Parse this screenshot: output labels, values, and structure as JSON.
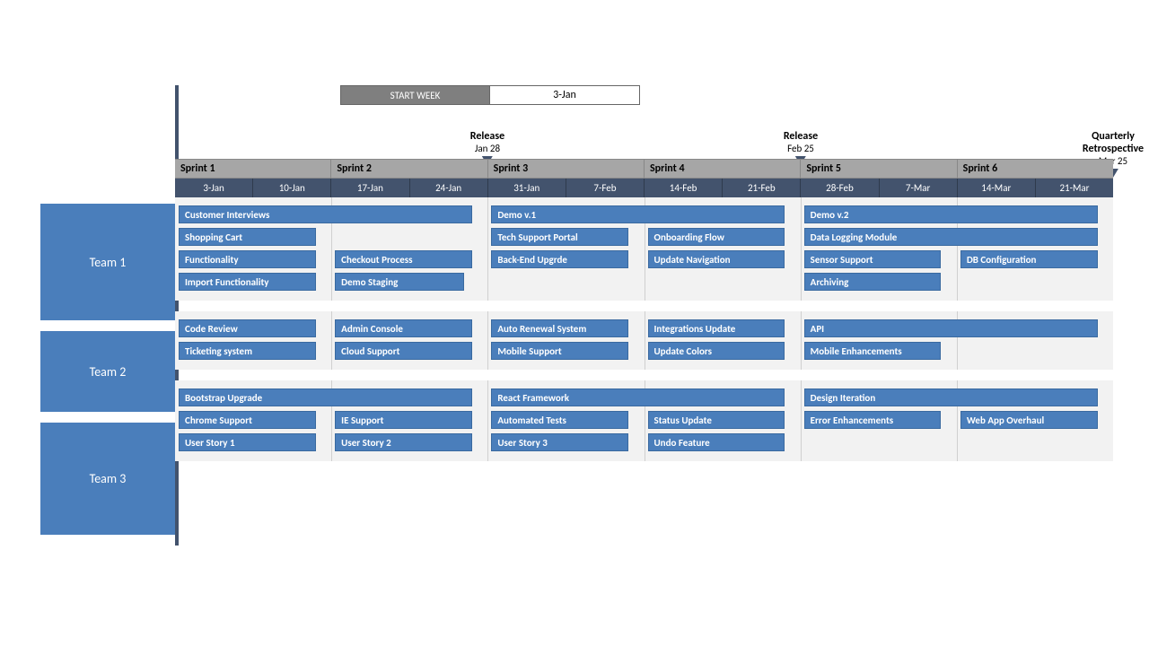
{
  "startWeek": {
    "label": "START WEEK",
    "value": "3-Jan"
  },
  "milestones": [
    {
      "title": "Release",
      "date": "Jan 28",
      "leftPct": 33.3
    },
    {
      "title": "Release",
      "date": "Feb 25",
      "leftPct": 66.7
    },
    {
      "title": "Quarterly Retrospective",
      "date": "Mar 25",
      "leftPct": 100
    }
  ],
  "sprints": [
    "Sprint 1",
    "Sprint 2",
    "Sprint 3",
    "Sprint 4",
    "Sprint 5",
    "Sprint 6"
  ],
  "dates": [
    "3-Jan",
    "10-Jan",
    "17-Jan",
    "24-Jan",
    "31-Jan",
    "7-Feb",
    "14-Feb",
    "21-Feb",
    "28-Feb",
    "7-Mar",
    "14-Mar",
    "21-Mar"
  ],
  "teams": [
    {
      "name": "Team 1",
      "class": "t1",
      "rows": [
        [
          {
            "label": "Customer Interviews",
            "start": 0,
            "span": 3.8
          },
          {
            "label": "Demo v.1",
            "start": 4,
            "span": 3.8
          },
          {
            "label": "Demo v.2",
            "start": 8,
            "span": 3.8
          }
        ],
        [
          {
            "label": "Shopping Cart",
            "start": 0,
            "span": 1.8
          },
          {
            "label": "Tech Support Portal",
            "start": 4,
            "span": 1.8
          },
          {
            "label": "Onboarding Flow",
            "start": 6,
            "span": 1.8
          },
          {
            "label": "Data Logging Module",
            "start": 8,
            "span": 3.8
          }
        ],
        [
          {
            "label": "Functionality",
            "start": 0,
            "span": 1.8
          },
          {
            "label": "Checkout Process",
            "start": 2,
            "span": 1.8
          },
          {
            "label": "Back-End Upgrde",
            "start": 4,
            "span": 1.8
          },
          {
            "label": "Update Navigation",
            "start": 6,
            "span": 1.8
          },
          {
            "label": "Sensor Support",
            "start": 8,
            "span": 1.8
          },
          {
            "label": "DB Configuration",
            "start": 10,
            "span": 1.8
          }
        ],
        [
          {
            "label": "Import Functionality",
            "start": 0,
            "span": 1.8
          },
          {
            "label": "Demo Staging",
            "start": 2,
            "span": 1.7
          },
          {
            "label": "Archiving",
            "start": 8,
            "span": 1.8
          }
        ]
      ]
    },
    {
      "name": "Team 2",
      "class": "t2",
      "rows": [
        [
          {
            "label": "Code Review",
            "start": 0,
            "span": 1.8
          },
          {
            "label": "Admin Console",
            "start": 2,
            "span": 1.8
          },
          {
            "label": "Auto Renewal System",
            "start": 4,
            "span": 1.8
          },
          {
            "label": "Integrations Update",
            "start": 6,
            "span": 1.8
          },
          {
            "label": "API",
            "start": 8,
            "span": 3.8
          }
        ],
        [
          {
            "label": "Ticketing system",
            "start": 0,
            "span": 1.8
          },
          {
            "label": "Cloud Support",
            "start": 2,
            "span": 1.8
          },
          {
            "label": "Mobile Support",
            "start": 4,
            "span": 1.8
          },
          {
            "label": "Update Colors",
            "start": 6,
            "span": 1.8
          },
          {
            "label": "Mobile Enhancements",
            "start": 8,
            "span": 1.8
          }
        ]
      ]
    },
    {
      "name": "Team 3",
      "class": "t3",
      "rows": [
        [
          {
            "label": "Bootstrap Upgrade",
            "start": 0,
            "span": 3.8
          },
          {
            "label": "React Framework",
            "start": 4,
            "span": 3.8
          },
          {
            "label": "Design Iteration",
            "start": 8,
            "span": 3.8
          }
        ],
        [
          {
            "label": "Chrome Support",
            "start": 0,
            "span": 1.8
          },
          {
            "label": "IE Support",
            "start": 2,
            "span": 1.8
          },
          {
            "label": "Automated Tests",
            "start": 4,
            "span": 1.8
          },
          {
            "label": "Status Update",
            "start": 6,
            "span": 1.8
          },
          {
            "label": "Error Enhancements",
            "start": 8,
            "span": 1.8
          },
          {
            "label": "Web App Overhaul",
            "start": 10,
            "span": 1.8
          }
        ],
        [
          {
            "label": "User Story 1",
            "start": 0,
            "span": 1.8
          },
          {
            "label": "User Story 2",
            "start": 2,
            "span": 1.8
          },
          {
            "label": "User Story 3",
            "start": 4,
            "span": 1.8
          },
          {
            "label": "Undo Feature",
            "start": 6,
            "span": 1.8
          }
        ]
      ]
    }
  ],
  "chart_data": {
    "type": "gantt",
    "unit": "week",
    "weeks": [
      "3-Jan",
      "10-Jan",
      "17-Jan",
      "24-Jan",
      "31-Jan",
      "7-Feb",
      "14-Feb",
      "21-Feb",
      "28-Feb",
      "7-Mar",
      "14-Mar",
      "21-Mar"
    ],
    "sprints": [
      {
        "name": "Sprint 1",
        "startWeek": 0,
        "endWeek": 2
      },
      {
        "name": "Sprint 2",
        "startWeek": 2,
        "endWeek": 4
      },
      {
        "name": "Sprint 3",
        "startWeek": 4,
        "endWeek": 6
      },
      {
        "name": "Sprint 4",
        "startWeek": 6,
        "endWeek": 8
      },
      {
        "name": "Sprint 5",
        "startWeek": 8,
        "endWeek": 10
      },
      {
        "name": "Sprint 6",
        "startWeek": 10,
        "endWeek": 12
      }
    ],
    "milestones": [
      {
        "title": "Release",
        "date": "Jan 28",
        "week": 4
      },
      {
        "title": "Release",
        "date": "Feb 25",
        "week": 8
      },
      {
        "title": "Quarterly Retrospective",
        "date": "Mar 25",
        "week": 12
      }
    ],
    "teams": [
      {
        "name": "Team 1",
        "tasks": [
          {
            "name": "Customer Interviews",
            "startWeek": 0,
            "durationWeeks": 4
          },
          {
            "name": "Demo v.1",
            "startWeek": 4,
            "durationWeeks": 4
          },
          {
            "name": "Demo v.2",
            "startWeek": 8,
            "durationWeeks": 4
          },
          {
            "name": "Shopping Cart",
            "startWeek": 0,
            "durationWeeks": 2
          },
          {
            "name": "Tech Support Portal",
            "startWeek": 4,
            "durationWeeks": 2
          },
          {
            "name": "Onboarding Flow",
            "startWeek": 6,
            "durationWeeks": 2
          },
          {
            "name": "Data Logging Module",
            "startWeek": 8,
            "durationWeeks": 4
          },
          {
            "name": "Functionality",
            "startWeek": 0,
            "durationWeeks": 2
          },
          {
            "name": "Checkout Process",
            "startWeek": 2,
            "durationWeeks": 2
          },
          {
            "name": "Back-End Upgrde",
            "startWeek": 4,
            "durationWeeks": 2
          },
          {
            "name": "Update Navigation",
            "startWeek": 6,
            "durationWeeks": 2
          },
          {
            "name": "Sensor Support",
            "startWeek": 8,
            "durationWeeks": 2
          },
          {
            "name": "DB Configuration",
            "startWeek": 10,
            "durationWeeks": 2
          },
          {
            "name": "Import Functionality",
            "startWeek": 0,
            "durationWeeks": 2
          },
          {
            "name": "Demo Staging",
            "startWeek": 2,
            "durationWeeks": 2
          },
          {
            "name": "Archiving",
            "startWeek": 8,
            "durationWeeks": 2
          }
        ]
      },
      {
        "name": "Team 2",
        "tasks": [
          {
            "name": "Code Review",
            "startWeek": 0,
            "durationWeeks": 2
          },
          {
            "name": "Admin Console",
            "startWeek": 2,
            "durationWeeks": 2
          },
          {
            "name": "Auto Renewal System",
            "startWeek": 4,
            "durationWeeks": 2
          },
          {
            "name": "Integrations Update",
            "startWeek": 6,
            "durationWeeks": 2
          },
          {
            "name": "API",
            "startWeek": 8,
            "durationWeeks": 4
          },
          {
            "name": "Ticketing system",
            "startWeek": 0,
            "durationWeeks": 2
          },
          {
            "name": "Cloud Support",
            "startWeek": 2,
            "durationWeeks": 2
          },
          {
            "name": "Mobile Support",
            "startWeek": 4,
            "durationWeeks": 2
          },
          {
            "name": "Update Colors",
            "startWeek": 6,
            "durationWeeks": 2
          },
          {
            "name": "Mobile Enhancements",
            "startWeek": 8,
            "durationWeeks": 2
          }
        ]
      },
      {
        "name": "Team 3",
        "tasks": [
          {
            "name": "Bootstrap Upgrade",
            "startWeek": 0,
            "durationWeeks": 4
          },
          {
            "name": "React Framework",
            "startWeek": 4,
            "durationWeeks": 4
          },
          {
            "name": "Design Iteration",
            "startWeek": 8,
            "durationWeeks": 4
          },
          {
            "name": "Chrome Support",
            "startWeek": 0,
            "durationWeeks": 2
          },
          {
            "name": "IE Support",
            "startWeek": 2,
            "durationWeeks": 2
          },
          {
            "name": "Automated Tests",
            "startWeek": 4,
            "durationWeeks": 2
          },
          {
            "name": "Status Update",
            "startWeek": 6,
            "durationWeeks": 2
          },
          {
            "name": "Error Enhancements",
            "startWeek": 8,
            "durationWeeks": 2
          },
          {
            "name": "Web App Overhaul",
            "startWeek": 10,
            "durationWeeks": 2
          },
          {
            "name": "User Story 1",
            "startWeek": 0,
            "durationWeeks": 2
          },
          {
            "name": "User Story 2",
            "startWeek": 2,
            "durationWeeks": 2
          },
          {
            "name": "User Story 3",
            "startWeek": 4,
            "durationWeeks": 2
          },
          {
            "name": "Undo Feature",
            "startWeek": 6,
            "durationWeeks": 2
          }
        ]
      }
    ]
  }
}
